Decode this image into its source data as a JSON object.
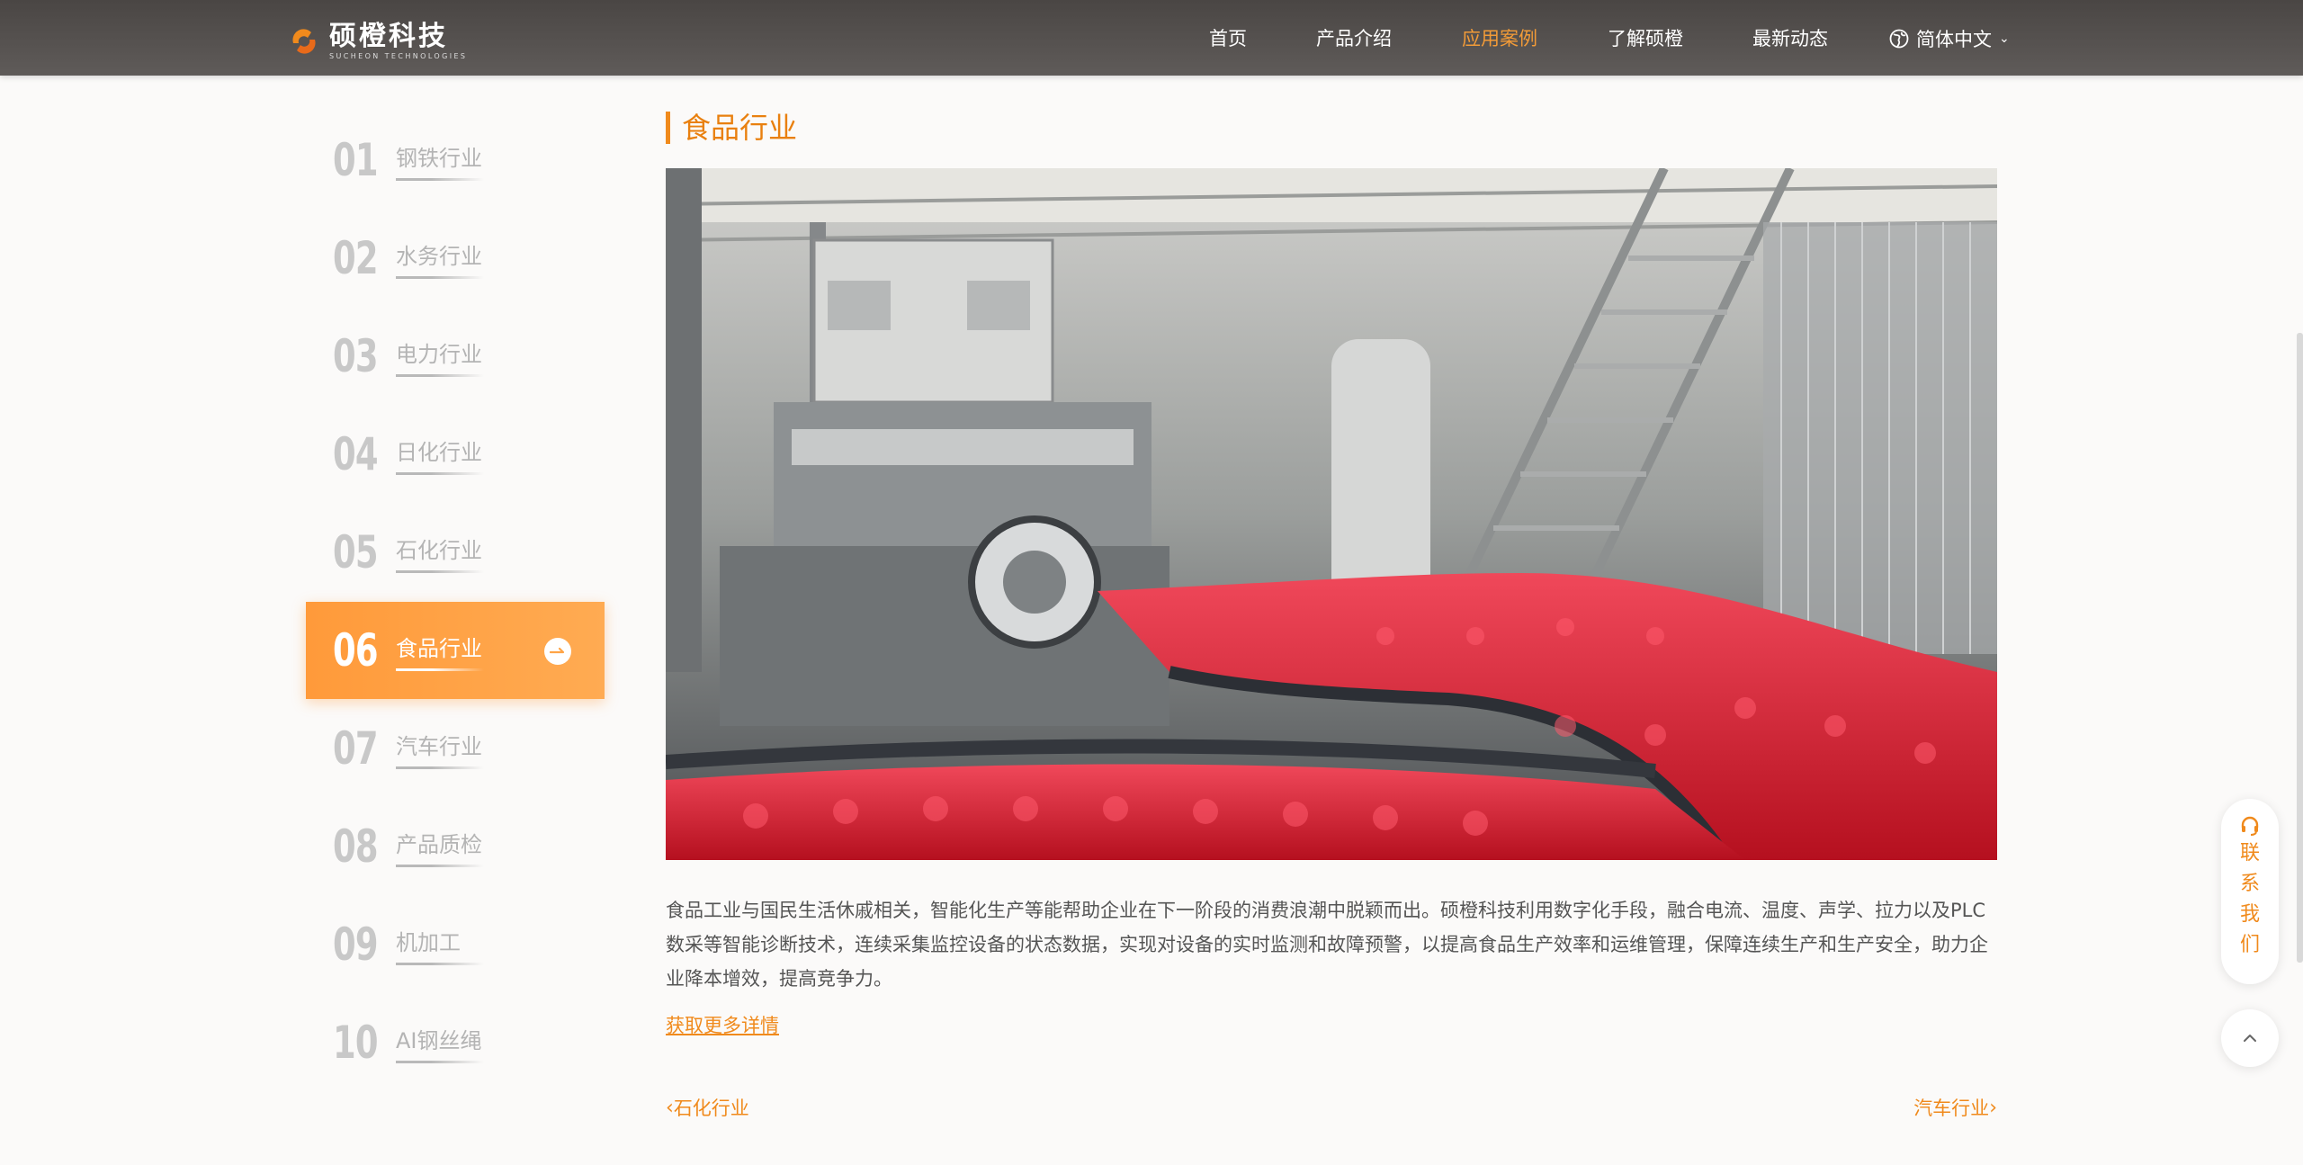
{
  "header": {
    "logo_cn": "硕橙科技",
    "logo_en": "SUCHEON TECHNOLOGIES",
    "nav": [
      {
        "label": "首页",
        "active": false
      },
      {
        "label": "产品介绍",
        "active": false
      },
      {
        "label": "应用案例",
        "active": true
      },
      {
        "label": "了解硕橙",
        "active": false
      },
      {
        "label": "最新动态",
        "active": false
      }
    ],
    "language": "简体中文",
    "accent_color": "#f29b38"
  },
  "sidebar": {
    "items": [
      {
        "num": "01",
        "label": "钢铁行业",
        "active": false
      },
      {
        "num": "02",
        "label": "水务行业",
        "active": false
      },
      {
        "num": "03",
        "label": "电力行业",
        "active": false
      },
      {
        "num": "04",
        "label": "日化行业",
        "active": false
      },
      {
        "num": "05",
        "label": "石化行业",
        "active": false
      },
      {
        "num": "06",
        "label": "食品行业",
        "active": true
      },
      {
        "num": "07",
        "label": "汽车行业",
        "active": false
      },
      {
        "num": "08",
        "label": "产品质检",
        "active": false
      },
      {
        "num": "09",
        "label": "机加工",
        "active": false
      },
      {
        "num": "10",
        "label": "AI钢丝绳",
        "active": false
      }
    ]
  },
  "main": {
    "title": "食品行业",
    "description": "食品工业与国民生活休戚相关，智能化生产等能帮助企业在下一阶段的消费浪潮中脱颖而出。硕橙科技利用数字化手段，融合电流、温度、声学、拉力以及PLC数采等智能诊断技术，连续采集监控设备的状态数据，实现对设备的实时监测和故障预警，以提高食品生产效率和运维管理，保障连续生产和生产安全，助力企业降本增效，提高竞争力。",
    "more_link": "获取更多详情",
    "prev": "石化行业",
    "next": "汽车行业"
  },
  "float": {
    "contact": "联系我们"
  },
  "colors": {
    "orange": "#f08a1c",
    "active_gradient_start": "#ff9a3a",
    "active_gradient_end": "#ffab52"
  }
}
